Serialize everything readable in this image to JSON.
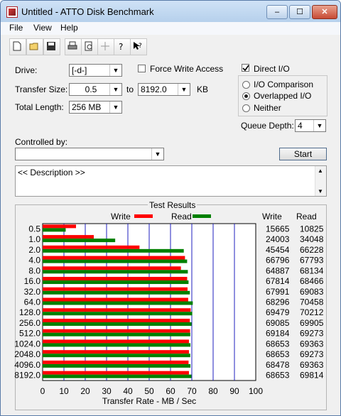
{
  "window": {
    "title": "Untitled - ATTO Disk Benchmark",
    "minimize": "–",
    "maximize": "☐",
    "close": "✕"
  },
  "menu": {
    "file": "File",
    "view": "View",
    "help": "Help"
  },
  "toolbar": {
    "new": "new-document-icon",
    "open": "open-folder-icon",
    "save": "save-icon",
    "print": "print-icon",
    "preview": "print-preview-icon",
    "move": "move-icon",
    "help": "help-icon",
    "context_help": "context-help-icon"
  },
  "form": {
    "drive_label": "Drive:",
    "drive_value": "[-d-]",
    "force_write_label": "Force Write Access",
    "direct_io_label": "Direct I/O",
    "transfer_size_label": "Transfer Size:",
    "transfer_from": "0.5",
    "to_label": "to",
    "transfer_to": "8192.0",
    "kb_label": "KB",
    "total_length_label": "Total Length:",
    "total_length_value": "256 MB",
    "io_comparison_label": "I/O Comparison",
    "overlapped_io_label": "Overlapped I/O",
    "neither_label": "Neither",
    "queue_depth_label": "Queue Depth:",
    "queue_depth_value": "4",
    "controlled_by_label": "Controlled by:",
    "controlled_by_value": "",
    "start_label": "Start",
    "description": "<< Description >>"
  },
  "results": {
    "title": "Test Results",
    "write_legend": "Write",
    "read_legend": "Read",
    "write_header": "Write",
    "read_header": "Read",
    "write_color": "#ff0000",
    "read_color": "#008000"
  },
  "chart_data": {
    "type": "bar",
    "title": "Test Results",
    "xlabel": "Transfer Rate - MB / Sec",
    "xlim": [
      0,
      100
    ],
    "xticks": [
      0,
      10,
      20,
      30,
      40,
      50,
      60,
      70,
      80,
      90,
      100
    ],
    "categories": [
      "0.5",
      "1.0",
      "2.0",
      "4.0",
      "8.0",
      "16.0",
      "32.0",
      "64.0",
      "128.0",
      "256.0",
      "512.0",
      "1024.0",
      "2048.0",
      "4096.0",
      "8192.0"
    ],
    "series": [
      {
        "name": "Write",
        "values": [
          15.665,
          24.003,
          45.454,
          66.796,
          64.887,
          67.814,
          67.991,
          68.296,
          69.479,
          69.085,
          69.184,
          68.653,
          68.653,
          68.478,
          68.653
        ]
      },
      {
        "name": "Read",
        "values": [
          10.825,
          34.048,
          66.228,
          67.793,
          68.134,
          68.466,
          69.083,
          70.458,
          70.212,
          69.905,
          69.273,
          69.363,
          69.273,
          69.363,
          69.814
        ]
      }
    ],
    "write_values_text": [
      "15665",
      "24003",
      "45454",
      "66796",
      "64887",
      "67814",
      "67991",
      "68296",
      "69479",
      "69085",
      "69184",
      "68653",
      "68653",
      "68478",
      "68653"
    ],
    "read_values_text": [
      "10825",
      "34048",
      "66228",
      "67793",
      "68134",
      "68466",
      "69083",
      "70458",
      "70212",
      "69905",
      "69273",
      "69363",
      "69273",
      "69363",
      "69814"
    ]
  }
}
